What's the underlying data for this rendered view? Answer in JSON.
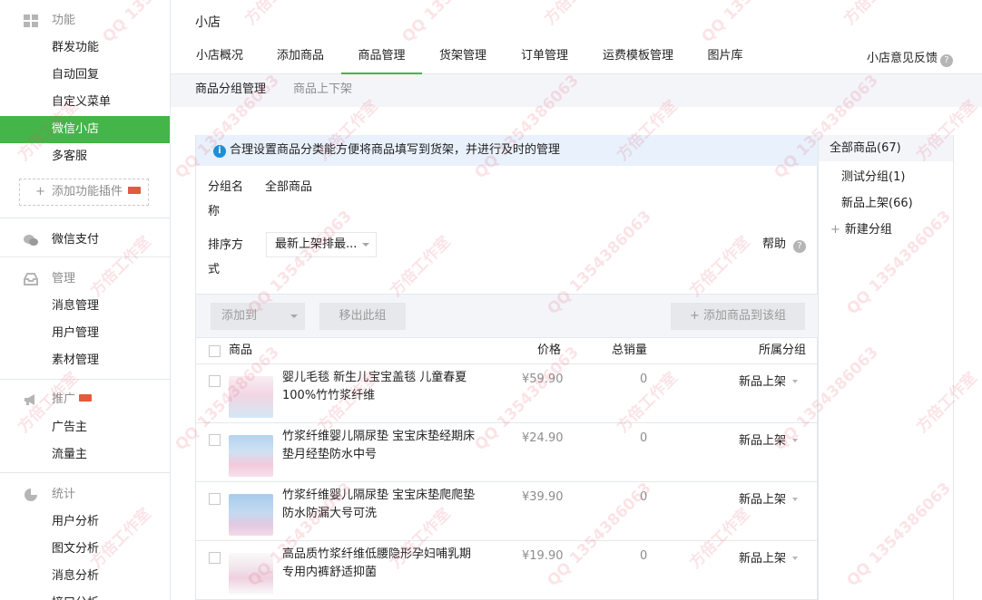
{
  "sidebar": {
    "sections": [
      {
        "title": "功能",
        "icon": "grid-icon",
        "items": [
          "群发功能",
          "自动回复",
          "自定义菜单",
          "微信小店",
          "多客服"
        ]
      },
      {
        "title": "微信支付",
        "icon": "wechat-pay-icon",
        "items": []
      },
      {
        "title": "管理",
        "icon": "inbox-icon",
        "items": [
          "消息管理",
          "用户管理",
          "素材管理"
        ]
      },
      {
        "title": "推广",
        "icon": "megaphone-icon",
        "items": [
          "广告主",
          "流量主"
        ]
      },
      {
        "title": "统计",
        "icon": "pie-chart-icon",
        "items": [
          "用户分析",
          "图文分析",
          "消息分析",
          "接口分析"
        ]
      }
    ],
    "active_item": "微信小店",
    "add_plugin": "添加功能插件"
  },
  "page": {
    "title": "小店",
    "tabs": [
      "小店概况",
      "添加商品",
      "商品管理",
      "货架管理",
      "订单管理",
      "运费模板管理",
      "图片库"
    ],
    "active_tab": "商品管理",
    "feedback": "小店意见反馈",
    "subtabs": [
      "商品分组管理",
      "商品上下架"
    ]
  },
  "tip": "合理设置商品分类能方便将商品填写到货架，并进行及时的管理",
  "filters": {
    "group_name_label_1": "分组名",
    "group_name_label_2": "称",
    "group_name_value": "全部商品",
    "sort_label_1": "排序方",
    "sort_label_2": "式",
    "sort_value": "最新上架排最...",
    "help": "帮助"
  },
  "toolbar": {
    "add_to": "添加到",
    "remove": "移出此组",
    "add_product": "+ 添加商品到该组"
  },
  "table": {
    "headers": {
      "product": "商品",
      "price": "价格",
      "sales": "总销量",
      "group": "所属分组"
    },
    "rows": [
      {
        "name": "婴儿毛毯 新生儿宝宝盖毯 儿童春夏100%竹竹浆纤维",
        "price": "¥59.90",
        "sales": "0",
        "group": "新品上架",
        "thumb_color": "#f3d9e6"
      },
      {
        "name": "竹浆纤维婴儿隔尿垫 宝宝床垫经期床垫月经垫防水中号",
        "price": "¥24.90",
        "sales": "0",
        "group": "新品上架",
        "thumb_color": "#bcd8f0"
      },
      {
        "name": "竹浆纤维婴儿隔尿垫 宝宝床垫爬爬垫防水防漏大号可洗",
        "price": "¥39.90",
        "sales": "0",
        "group": "新品上架",
        "thumb_color": "#b9d3ef"
      },
      {
        "name": "高品质竹浆纤维低腰隐形孕妇哺乳期专用内裤舒适抑菌",
        "price": "¥19.90",
        "sales": "0",
        "group": "新品上架",
        "thumb_color": "#f0dbe6"
      }
    ]
  },
  "groups": {
    "all": "全部商品(67)",
    "items": [
      "测试分组(1)",
      "新品上架(66)"
    ],
    "new": "新建分组"
  },
  "watermark": {
    "text_a": "方倍工作室",
    "text_b": "QQ 1354386063"
  },
  "colors": {
    "accent": "#44b549",
    "tip_bg": "#e8f1fc",
    "info": "#1e8fd8",
    "hot": "#e55a3c"
  }
}
